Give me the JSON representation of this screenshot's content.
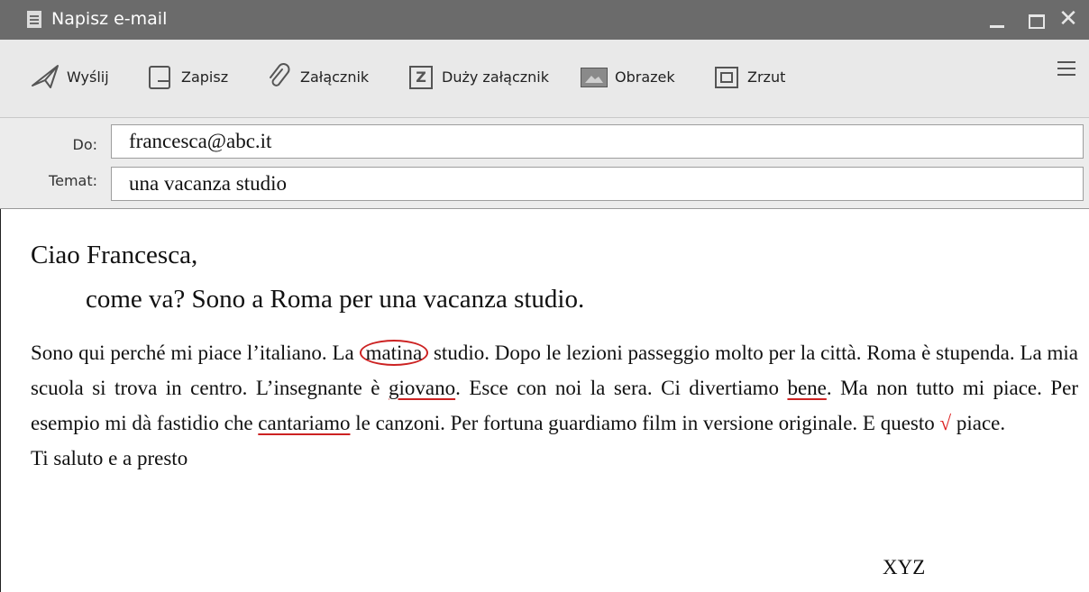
{
  "window": {
    "title": "Napisz e-mail",
    "close_glyph": "✕"
  },
  "toolbar": {
    "send": "Wyślij",
    "save": "Zapisz",
    "attachment": "Załącznik",
    "large_attachment": "Duży załącznik",
    "image": "Obrazek",
    "screenshot": "Zrzut",
    "large_attachment_icon_letter": "Z"
  },
  "fields": {
    "to_label": "Do:",
    "to_value": "francesca@abc.it",
    "subject_label": "Temat:",
    "subject_value": "una vacanza studio"
  },
  "message": {
    "greeting": "Ciao Francesca,",
    "intro": "come va? Sono a Roma per una vacanza studio.",
    "p_1": "Sono qui perché mi piace l’italiano. La",
    "w_circled": "matina",
    "p_2": "studio. Dopo le lezioni passeggio molto per la città. Roma è stupenda. La mia scuola si trova in centro. L’insegnante è",
    "w_under_1": "giovano",
    "p_3": ". Esce con noi la sera. Ci divertiamo",
    "w_under_2": "bene",
    "p_4": ". Ma non tutto mi piace. Per esempio mi dà fastidio che",
    "w_under_3": "cantariamo",
    "p_5": "le canzoni. Per fortuna guardiamo film in versione originale. E questo",
    "check_mark": "√",
    "p_6": "piace.",
    "closing": "Ti saluto e a presto",
    "signature": "XYZ"
  },
  "colors": {
    "titlebar": "#6b6b6b",
    "toolbar": "#e9e9e9",
    "correction_red": "#cc2222"
  },
  "icons": [
    "document-icon",
    "send-icon",
    "save-icon",
    "paperclip-icon",
    "large-attachment-icon",
    "image-icon",
    "screenshot-icon",
    "menu-icon"
  ]
}
